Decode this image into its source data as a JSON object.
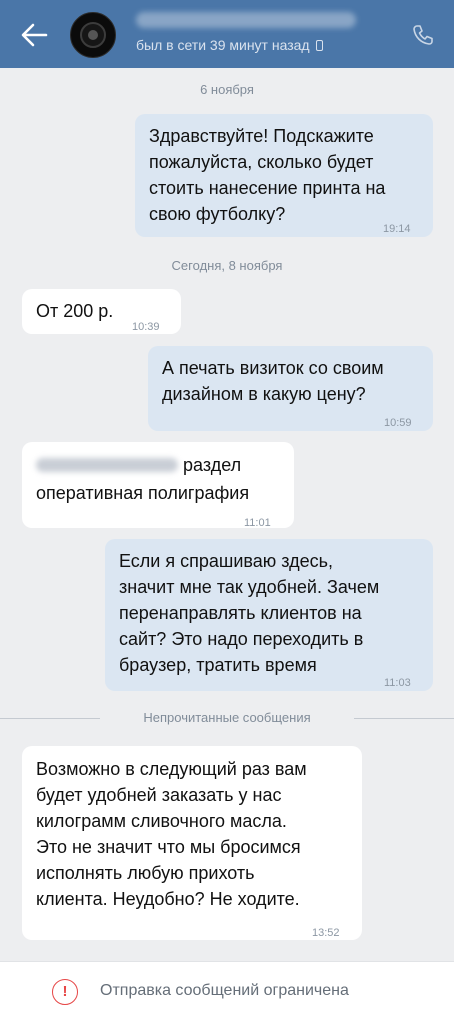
{
  "header": {
    "contact_name": "",
    "status": "был в сети 39 минут назад",
    "icons": {
      "back": "arrow-left-icon",
      "device": "phone-device-icon",
      "call": "phone-call-icon"
    },
    "color": "#4a76a8"
  },
  "dates": {
    "first": "6 ноября",
    "second": "Сегодня, 8 ноября"
  },
  "messages": [
    {
      "direction": "out",
      "text": "Здравствуйте! Подскажите\nпожалуйста, сколько будет\nстоить нанесение принта на\nсвою футболку?",
      "time": "19:14"
    },
    {
      "direction": "in",
      "text": "От 200 р.",
      "time": "10:39"
    },
    {
      "direction": "out",
      "text": "А печать визиток со своим\nдизайном в какую цену?",
      "time": "10:59"
    },
    {
      "direction": "in",
      "text_line1": "раздел",
      "text_line2": "оперативная полиграфия",
      "time": "11:01"
    },
    {
      "direction": "out",
      "text": "Если я спрашиваю здесь,\nзначит мне так удобней. Зачем\nперенаправлять клиентов на\nсайт? Это надо переходить в\nбраузер, тратить время",
      "time": "11:03"
    },
    {
      "direction": "in",
      "text": "Возможно в следующий раз вам\nбудет удобней заказать у нас\nкилограмм сливочного масла.\nЭто не значит что мы бросимся\nисполнять любую прихоть\nклиента. Неудобно? Не ходите.",
      "time": "13:52"
    }
  ],
  "unread_label": "Непрочитанные сообщения",
  "footer": {
    "icon": "warning-circle-icon",
    "icon_glyph": "!",
    "text": "Отправка сообщений ограничена"
  }
}
